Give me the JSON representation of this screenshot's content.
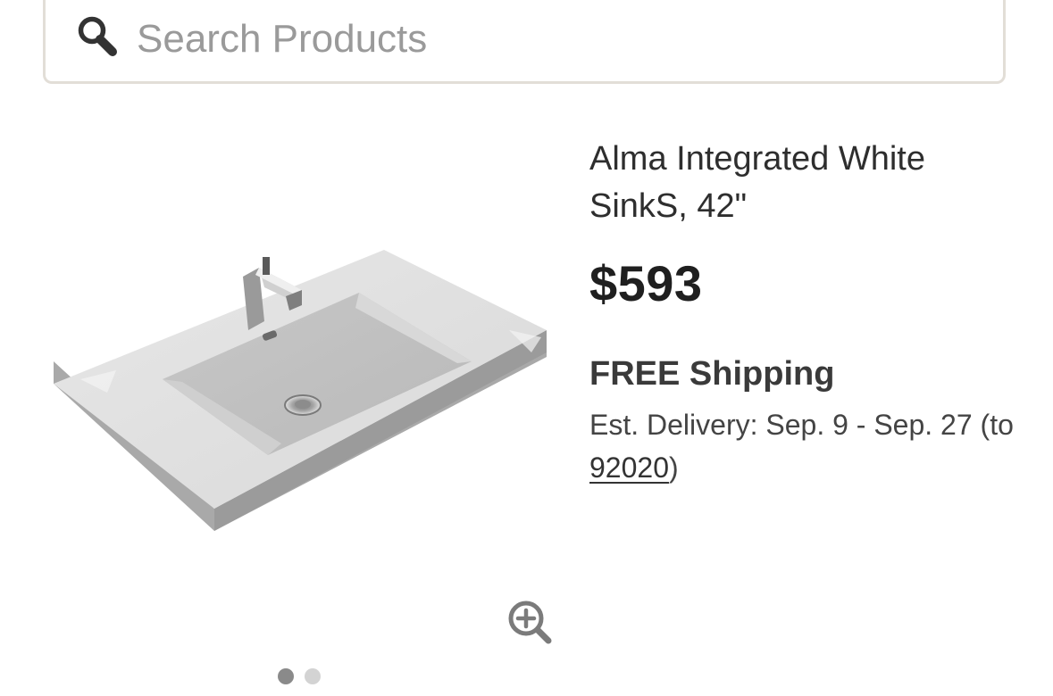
{
  "search": {
    "placeholder": "Search Products",
    "value": ""
  },
  "icons": {
    "search": "search-icon",
    "zoom": "zoom-in-icon"
  },
  "product": {
    "title": "Alma Integrated White SinkS, 42\"",
    "price": "$593",
    "shipping": "FREE Shipping",
    "delivery_prefix": "Est. Delivery: Sep. 9 - Sep. 27 (to ",
    "zip": "92020",
    "delivery_suffix": ")"
  },
  "carousel": {
    "total": 2,
    "active_index": 0
  },
  "colors": {
    "search_border": "#e2ded7",
    "text": "#2a2a2a",
    "dot_active": "#8a8a8a",
    "dot_inactive": "#d3d3d3"
  }
}
